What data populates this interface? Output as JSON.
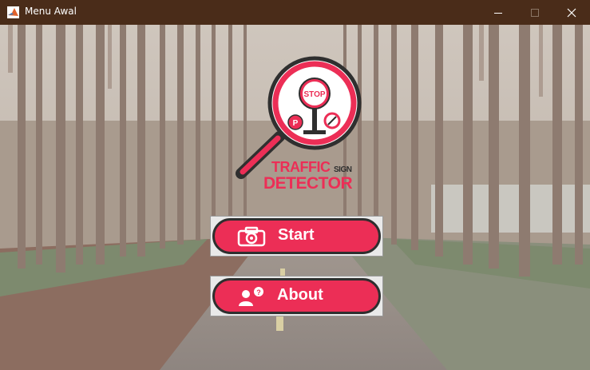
{
  "window": {
    "title": "Menu Awal",
    "controls": [
      "minimize",
      "maximize",
      "close"
    ]
  },
  "logo": {
    "stop_text": "STOP",
    "line1": "TRAFFIC",
    "line1_small": "SIGN",
    "line2": "DETECTOR"
  },
  "buttons": {
    "start_label": "Start",
    "about_label": "About"
  },
  "colors": {
    "accent": "#ec2e56",
    "dark": "#2f2f2f",
    "titlebar": "#4a2c19"
  }
}
